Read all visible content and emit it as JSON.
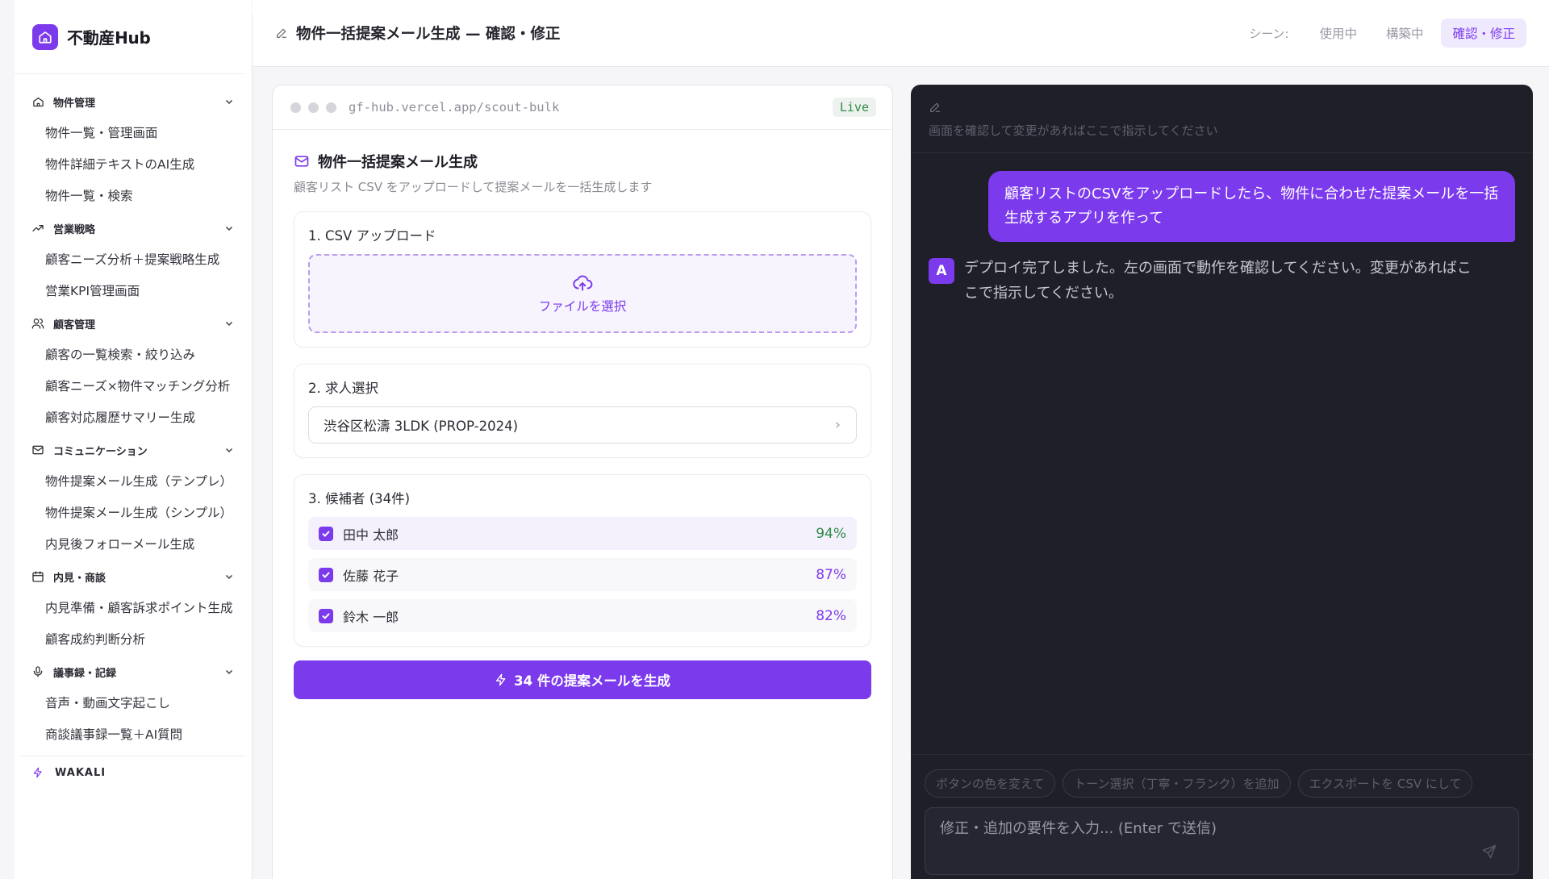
{
  "brand": {
    "name": "不動産Hub"
  },
  "sidebar": {
    "groups": [
      {
        "label": "物件管理",
        "icon": "home-icon",
        "items": [
          "物件一覧・管理画面",
          "物件詳細テキストのAI生成",
          "物件一覧・検索"
        ]
      },
      {
        "label": "営業戦略",
        "icon": "trending-up-icon",
        "items": [
          "顧客ニーズ分析＋提案戦略生成",
          "営業KPI管理画面"
        ]
      },
      {
        "label": "顧客管理",
        "icon": "users-icon",
        "items": [
          "顧客の一覧検索・絞り込み",
          "顧客ニーズ×物件マッチング分析",
          "顧客対応履歴サマリー生成"
        ]
      },
      {
        "label": "コミュニケーション",
        "icon": "mail-icon",
        "items": [
          "物件提案メール生成（テンプレ）",
          "物件提案メール生成（シンプル）",
          "内見後フォローメール生成"
        ]
      },
      {
        "label": "内見・商談",
        "icon": "calendar-icon",
        "items": [
          "内見準備・顧客訴求ポイント生成",
          "顧客成約判断分析"
        ]
      },
      {
        "label": "議事録・記録",
        "icon": "mic-icon",
        "items": [
          "音声・動画文字起こし",
          "商談議事録一覧＋AI質問"
        ]
      }
    ],
    "footer_label": "WAKALI"
  },
  "header": {
    "title": "物件一括提案メール生成 — 確認・修正",
    "scene_label": "シーン:",
    "scenes": [
      "使用中",
      "構築中",
      "確認・修正"
    ],
    "active_scene": "確認・修正"
  },
  "preview": {
    "url": "gf-hub.vercel.app/scout-bulk",
    "status": "Live",
    "app": {
      "title": "物件一括提案メール生成",
      "subtitle": "顧客リスト CSV をアップロードして提案メールを一括生成します",
      "step1_label": "1. CSV アップロード",
      "upload_label": "ファイルを選択",
      "step2_label": "2. 求人選択",
      "selected_property": "渋谷区松濤 3LDK (PROP-2024)",
      "step3_label": "3. 候補者 (34件)",
      "candidates": [
        {
          "name": "田中 太郎",
          "score": "94%",
          "checked": true
        },
        {
          "name": "佐藤 花子",
          "score": "87%",
          "checked": true
        },
        {
          "name": "鈴木 一郎",
          "score": "82%",
          "checked": true
        }
      ],
      "generate_label": "34 件の提案メールを生成"
    }
  },
  "chat": {
    "hint": "画面を確認して変更があればここで指示してください",
    "user_message": "顧客リストのCSVをアップロードしたら、物件に合わせた提案メールを一括生成するアプリを作って",
    "ai_avatar": "A",
    "ai_message": "デプロイ完了しました。左の画面で動作を確認してください。変更があればここで指示してください。",
    "suggestions": [
      "ボタンの色を変えて",
      "トーン選択（丁寧・フランク）を追加",
      "エクスポートを CSV にして"
    ],
    "input_placeholder": "修正・追加の要件を入力... (Enter で送信)"
  },
  "colors": {
    "accent": "#7c3aed",
    "chat_bg": "#1f1f29",
    "live_green": "#2f8a45"
  }
}
